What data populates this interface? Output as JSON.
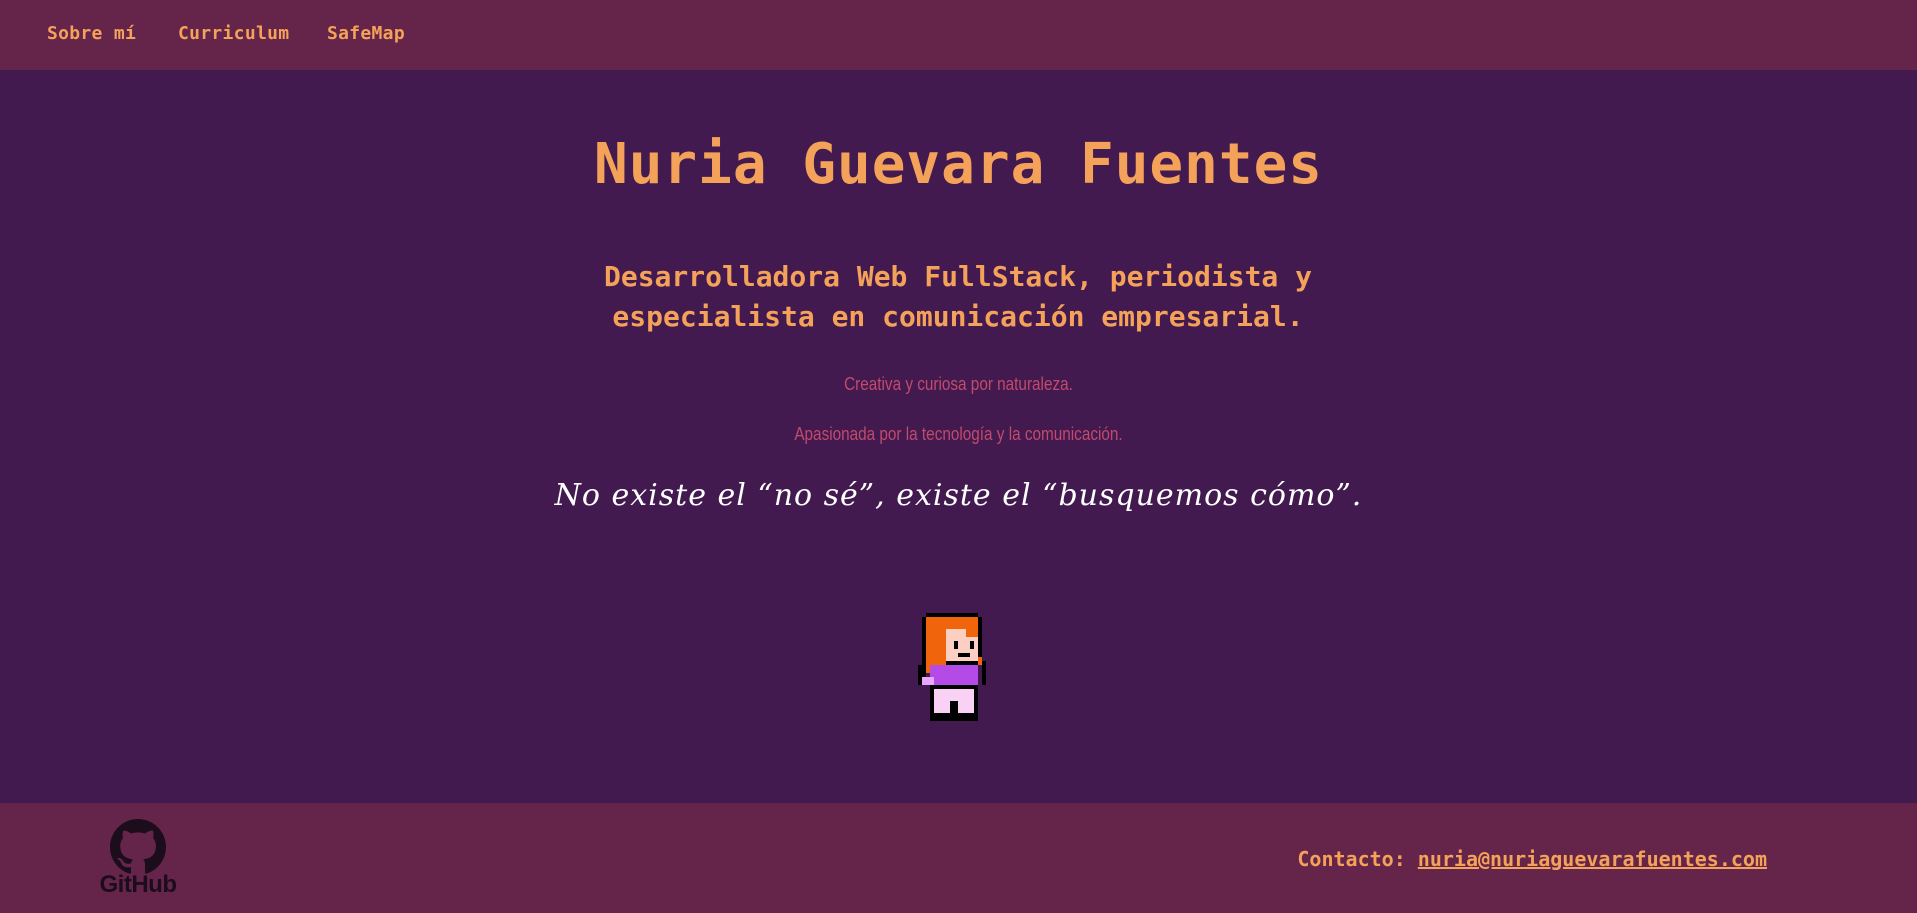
{
  "nav": {
    "items": [
      {
        "label": "Sobre mí"
      },
      {
        "label": "Curriculum"
      },
      {
        "label": "SafeMap"
      }
    ]
  },
  "hero": {
    "title": "Nuria Guevara Fuentes",
    "subtitle": "Desarrolladora Web FullStack, periodista y especialista en comunicación empresarial.",
    "tagline_1": "Creativa y curiosa por naturaleza.",
    "tagline_2": "Apasionada por la tecnología y la comunicación.",
    "motto": "No existe el “no sé”, existe el “busquemos cómo”."
  },
  "footer": {
    "github_label": "GitHub",
    "contact_prefix": "Contacto:",
    "contact_email": "nuria@nuriaguevarafuentes.com"
  },
  "colors": {
    "background": "#421a4f",
    "bar": "#65254a",
    "accent": "#f4a259",
    "tagline": "#c24a6c",
    "motto": "#ffffff"
  },
  "icons": {
    "github": "github-octocat-icon",
    "avatar": "pixel-girl-avatar"
  }
}
